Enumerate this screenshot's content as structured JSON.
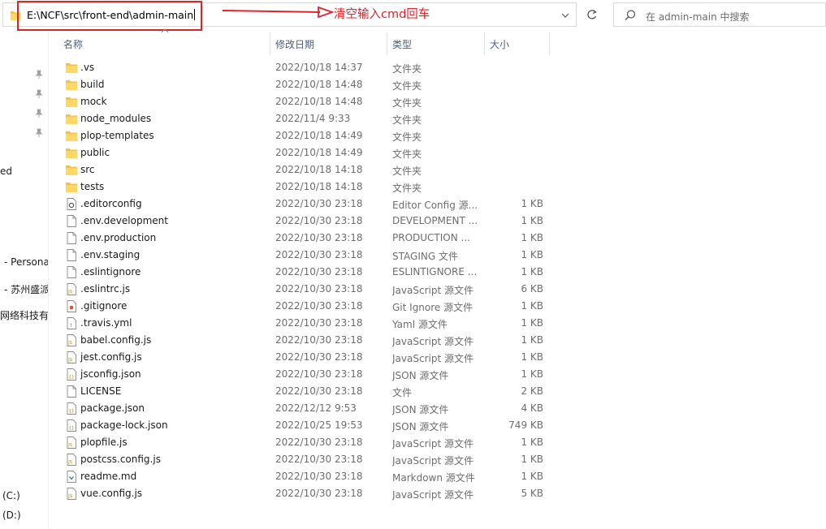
{
  "address": {
    "path": "E:\\NCF\\src\\front-end\\admin-main"
  },
  "annotation": {
    "text": "清空输入cmd回车",
    "color": "#e2242a"
  },
  "search": {
    "placeholder": "在 admin-main 中搜索"
  },
  "columns": {
    "name": "名称",
    "date": "修改日期",
    "type": "类型",
    "size": "大小"
  },
  "nav": {
    "items": [
      "ed",
      "- Persona",
      "- 苏州盛派",
      "网络科技有限",
      "(C:)",
      "(D:)"
    ]
  },
  "files": [
    {
      "name": ".vs",
      "date": "2022/10/18 14:37",
      "type": "文件夹",
      "size": "",
      "kind": "folder"
    },
    {
      "name": "build",
      "date": "2022/10/18 14:48",
      "type": "文件夹",
      "size": "",
      "kind": "folder"
    },
    {
      "name": "mock",
      "date": "2022/10/18 14:48",
      "type": "文件夹",
      "size": "",
      "kind": "folder"
    },
    {
      "name": "node_modules",
      "date": "2022/11/4 9:33",
      "type": "文件夹",
      "size": "",
      "kind": "folder"
    },
    {
      "name": "plop-templates",
      "date": "2022/10/18 14:49",
      "type": "文件夹",
      "size": "",
      "kind": "folder"
    },
    {
      "name": "public",
      "date": "2022/10/18 14:49",
      "type": "文件夹",
      "size": "",
      "kind": "folder"
    },
    {
      "name": "src",
      "date": "2022/10/18 14:18",
      "type": "文件夹",
      "size": "",
      "kind": "folder"
    },
    {
      "name": "tests",
      "date": "2022/10/18 14:18",
      "type": "文件夹",
      "size": "",
      "kind": "folder"
    },
    {
      "name": ".editorconfig",
      "date": "2022/10/30 23:18",
      "type": "Editor Config 源...",
      "size": "1 KB",
      "kind": "gear"
    },
    {
      "name": ".env.development",
      "date": "2022/10/30 23:18",
      "type": "DEVELOPMENT ...",
      "size": "1 KB",
      "kind": "file"
    },
    {
      "name": ".env.production",
      "date": "2022/10/30 23:18",
      "type": "PRODUCTION ...",
      "size": "1 KB",
      "kind": "file"
    },
    {
      "name": ".env.staging",
      "date": "2022/10/30 23:18",
      "type": "STAGING 文件",
      "size": "1 KB",
      "kind": "file"
    },
    {
      "name": ".eslintignore",
      "date": "2022/10/30 23:18",
      "type": "ESLINTIGNORE ...",
      "size": "1 KB",
      "kind": "file"
    },
    {
      "name": ".eslintrc.js",
      "date": "2022/10/30 23:18",
      "type": "JavaScript 源文件",
      "size": "6 KB",
      "kind": "js"
    },
    {
      "name": ".gitignore",
      "date": "2022/10/30 23:18",
      "type": "Git Ignore 源文件",
      "size": "1 KB",
      "kind": "git"
    },
    {
      "name": ".travis.yml",
      "date": "2022/10/30 23:18",
      "type": "Yaml 源文件",
      "size": "1 KB",
      "kind": "yml"
    },
    {
      "name": "babel.config.js",
      "date": "2022/10/30 23:18",
      "type": "JavaScript 源文件",
      "size": "1 KB",
      "kind": "js"
    },
    {
      "name": "jest.config.js",
      "date": "2022/10/30 23:18",
      "type": "JavaScript 源文件",
      "size": "1 KB",
      "kind": "js"
    },
    {
      "name": "jsconfig.json",
      "date": "2022/10/30 23:18",
      "type": "JSON 源文件",
      "size": "1 KB",
      "kind": "json"
    },
    {
      "name": "LICENSE",
      "date": "2022/10/30 23:18",
      "type": "文件",
      "size": "2 KB",
      "kind": "file"
    },
    {
      "name": "package.json",
      "date": "2022/12/12 9:53",
      "type": "JSON 源文件",
      "size": "4 KB",
      "kind": "json"
    },
    {
      "name": "package-lock.json",
      "date": "2022/10/25 19:53",
      "type": "JSON 源文件",
      "size": "749 KB",
      "kind": "json"
    },
    {
      "name": "plopfile.js",
      "date": "2022/10/30 23:18",
      "type": "JavaScript 源文件",
      "size": "1 KB",
      "kind": "js"
    },
    {
      "name": "postcss.config.js",
      "date": "2022/10/30 23:18",
      "type": "JavaScript 源文件",
      "size": "1 KB",
      "kind": "js"
    },
    {
      "name": "readme.md",
      "date": "2022/10/30 23:18",
      "type": "Markdown 源文件",
      "size": "1 KB",
      "kind": "md"
    },
    {
      "name": "vue.config.js",
      "date": "2022/10/30 23:18",
      "type": "JavaScript 源文件",
      "size": "5 KB",
      "kind": "js"
    }
  ]
}
